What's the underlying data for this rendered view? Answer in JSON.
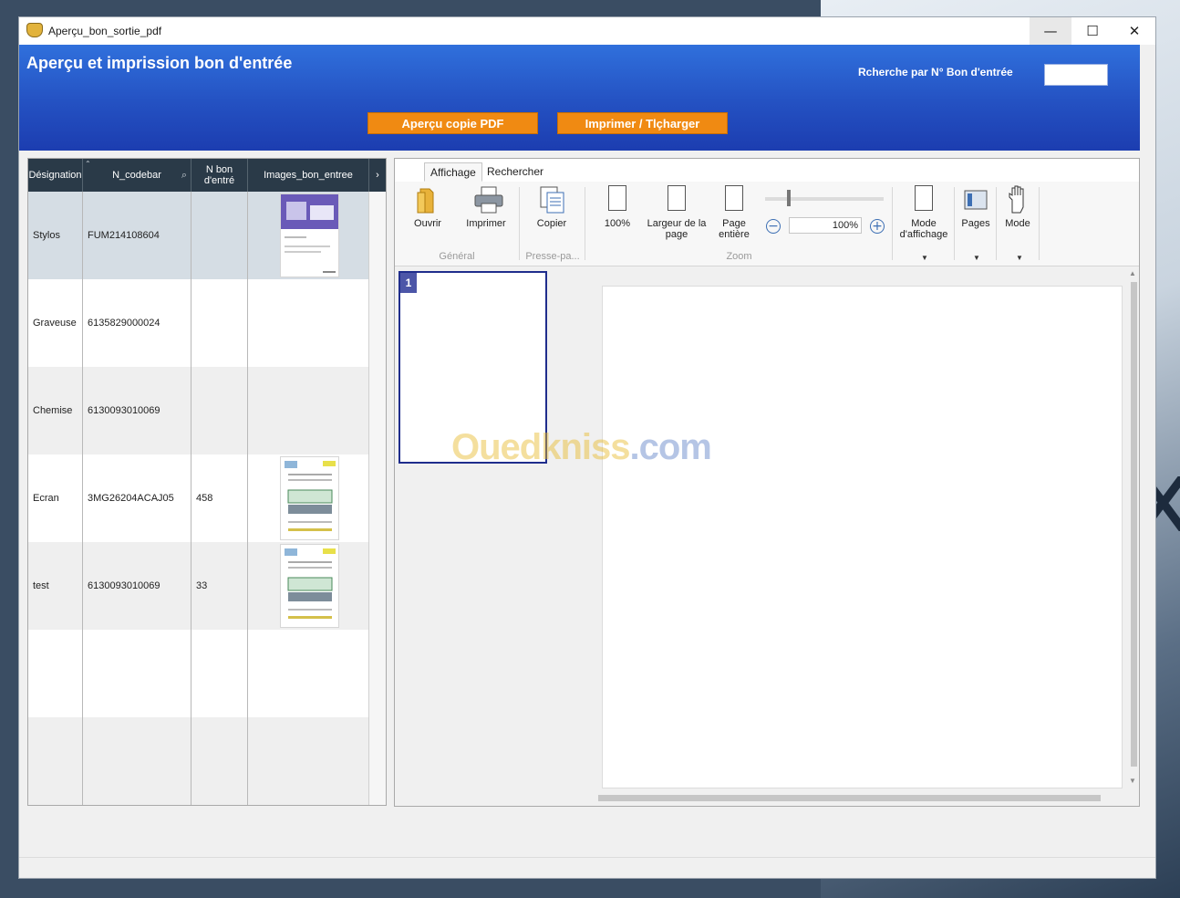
{
  "window": {
    "title": "Aperçu_bon_sortie_pdf",
    "minimize": "—",
    "maximize": "☐",
    "close": "✕"
  },
  "header": {
    "title": "Aperçu et imprission bon d'entrée",
    "search_label": "Rcherche par N° Bon d'entrée",
    "search_value": "",
    "btn_preview": "Aperçu copie PDF",
    "btn_print": "Imprimer / Tlçharger"
  },
  "grid": {
    "columns": [
      "Désignation",
      "N_codebar",
      "N bon d'entré",
      "Images_bon_entree"
    ],
    "rows": [
      {
        "designation": "Stylos",
        "codebar": "FUM214108604",
        "n_bon": "",
        "has_image": true
      },
      {
        "designation": "Graveuse",
        "codebar": "6135829000024",
        "n_bon": "",
        "has_image": false
      },
      {
        "designation": "Chemise",
        "codebar": "6130093010069",
        "n_bon": "",
        "has_image": false
      },
      {
        "designation": "Ecran",
        "codebar": "3MG26204ACAJ05",
        "n_bon": "458",
        "has_image": true
      },
      {
        "designation": "test",
        "codebar": "6130093010069",
        "n_bon": "33",
        "has_image": true
      }
    ]
  },
  "viewer": {
    "tabs": [
      "Affichage",
      "Rechercher"
    ],
    "buttons": {
      "open": "Ouvrir",
      "print": "Imprimer",
      "copy": "Copier",
      "zoom100": "100%",
      "page_width": "Largeur de la page",
      "whole_page": "Page entière",
      "view_mode": "Mode d'affichage",
      "pages": "Pages",
      "mode": "Mode"
    },
    "groups": {
      "general": "Général",
      "clipboard": "Presse-pa...",
      "zoom": "Zoom"
    },
    "zoom_value": "100%",
    "page_number": "1"
  },
  "watermark": {
    "part1": "Ouedkniss",
    "part2": ".com"
  }
}
